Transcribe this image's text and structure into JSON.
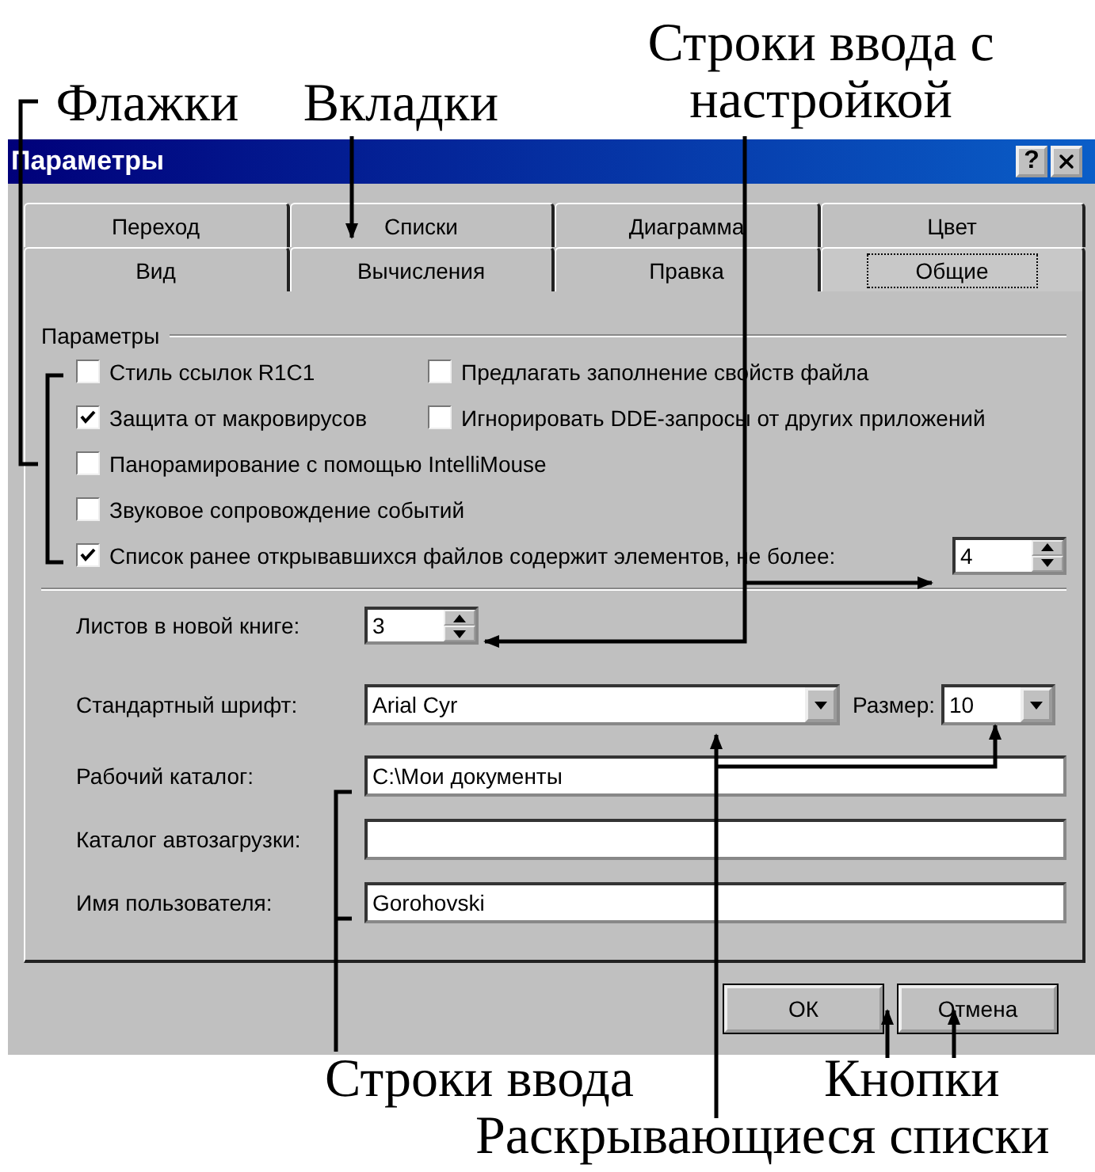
{
  "callouts_top": [
    "Флажки",
    "Вкладки",
    "Строки ввода с настройкой"
  ],
  "dialog": {
    "title": "Параметры",
    "help": "?",
    "tab_rows": [
      [
        {
          "label": "Переход",
          "selected": false
        },
        {
          "label": "Списки",
          "selected": false
        },
        {
          "label": "Диаграмма",
          "selected": false
        },
        {
          "label": "Цвет",
          "selected": false
        }
      ],
      [
        {
          "label": "Вид",
          "selected": false
        },
        {
          "label": "Вычисления",
          "selected": false
        },
        {
          "label": "Правка",
          "selected": false
        },
        {
          "label": "Общие",
          "selected": true
        }
      ]
    ],
    "group_title": "Параметры",
    "checkbox_rows": [
      [
        {
          "label": "Стиль ссылок R1C1",
          "checked": false
        },
        {
          "label": "Предлагать заполнение свойств файла",
          "checked": false
        }
      ],
      [
        {
          "label": "Защита от макровирусов",
          "checked": true
        },
        {
          "label": "Игнорировать DDE-запросы от других приложений",
          "checked": false
        }
      ],
      [
        {
          "label": "Панорамирование с помощью IntelliMouse",
          "checked": false
        }
      ],
      [
        {
          "label": "Звуковое сопровождение событий",
          "checked": false
        }
      ],
      [
        {
          "label": "Список ранее открывавшихся файлов содержит элементов, не более:",
          "checked": true
        }
      ]
    ],
    "recent_files_value": "4",
    "sheets": {
      "label": "Листов в новой книге:",
      "value": "3"
    },
    "font": {
      "label": "Стандартный шрифт:",
      "value": "Arial Cyr"
    },
    "size": {
      "label": "Размер:",
      "value": "10"
    },
    "text_fields": [
      {
        "label": "Рабочий каталог:",
        "value": "C:\\Мои документы"
      },
      {
        "label": "Каталог автозагрузки:"
      },
      {
        "label": "Имя пользователя:",
        "value": "Gorohovski"
      }
    ],
    "buttons": [
      "ОК",
      "Отмена"
    ]
  },
  "callouts_bottom": [
    "Строки ввода",
    "Кнопки",
    "Раскрывающиеся списки"
  ]
}
